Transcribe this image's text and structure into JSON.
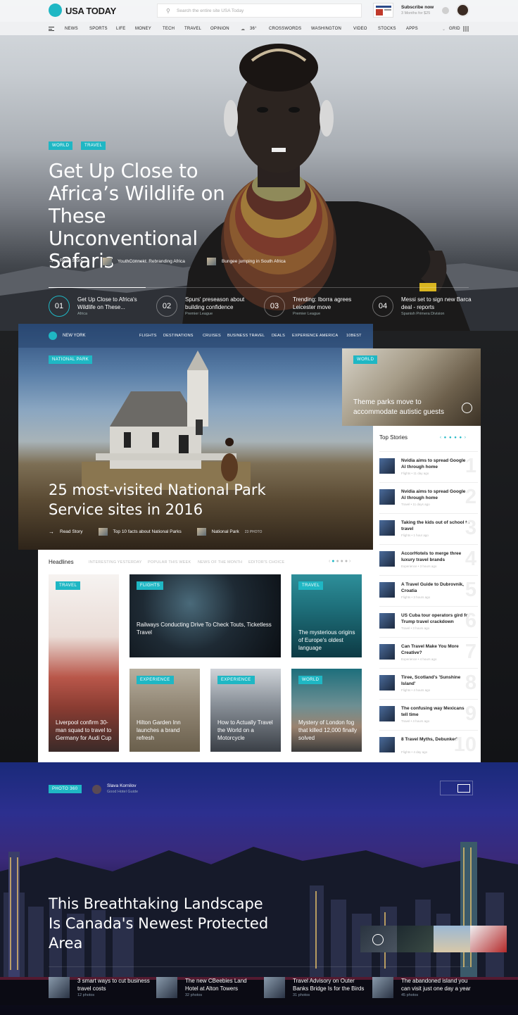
{
  "header": {
    "logo": "USA TODAY",
    "search_placeholder": "Search the entire site USA Today",
    "subscribe_title": "Subscribe now",
    "subscribe_sub": "3 Months for $25"
  },
  "nav": {
    "items": [
      "NEWS",
      "SPORTS",
      "LIFE",
      "MONEY",
      "TECH",
      "TRAVEL",
      "OPINION"
    ],
    "weather": "36°",
    "items2": [
      "CROSSWORDS",
      "WASHINGTON",
      "VIDEO",
      "STOCKS",
      "APPS"
    ],
    "grid_label": "GRID"
  },
  "hero": {
    "tags": [
      "WORLD",
      "TRAVEL"
    ],
    "title": "Get Up Close to Africa’s Wildlife on These Unconventional Safaris",
    "read_story": "Read Story",
    "related1": "YouthConnekt: Rebranding Africa",
    "related2": "Bungee jumping in South Africa",
    "stories": [
      {
        "num": "01",
        "title": "Get Up Close to Africa's Wildlife on These...",
        "sub": "Africa"
      },
      {
        "num": "02",
        "title": "Spurs' preseason about building confidence",
        "sub": "Premier League"
      },
      {
        "num": "03",
        "title": "Trending: Iborra agrees Leicester move",
        "sub": "Premier League"
      },
      {
        "num": "04",
        "title": "Messi set to sign new Barca deal - reports",
        "sub": "Spanish Primera Division"
      }
    ]
  },
  "travel": {
    "city": "NEW YORK",
    "nav": [
      "FLIGHTS",
      "DESTINATIONS",
      "CRUISES",
      "BUSINESS TRAVEL",
      "DEALS",
      "EXPERIENCE AMERICA",
      "10BEST"
    ],
    "tag": "NATIONAL PARK",
    "title": "25 most-visited National Park Service sites in 2016",
    "read_story": "Read Story",
    "related1": "Top 10 facts about National Parks",
    "related2": "National Park",
    "related2_count": "23 PHOTO"
  },
  "world_card": {
    "tag": "WORLD",
    "title": "Theme parks move to accommodate autistic guests"
  },
  "top_stories": {
    "title": "Top Stories",
    "items": [
      {
        "title": "Nvidia aims to spread Google AI through home",
        "cat": "Flights",
        "time": "11 day ago",
        "num": "1"
      },
      {
        "title": "Nvidia aims to spread Google AI through home",
        "cat": "Travel",
        "time": "11 days ago",
        "num": "2"
      },
      {
        "title": "Taking the kids out of school to travel",
        "cat": "Flights",
        "time": "1 hour ago",
        "num": "3"
      },
      {
        "title": "AccorHotels to merge three luxury travel brands",
        "cat": "Experience",
        "time": "3 hours ago",
        "num": "4"
      },
      {
        "title": "A Travel Guide to Dubrovnik, Croatia",
        "cat": "Flights",
        "time": "3 hours ago",
        "num": "5"
      },
      {
        "title": "US Cuba tour operators gird for Trump travel crackdown",
        "cat": "Travel",
        "time": "3 hours ago",
        "num": "6"
      },
      {
        "title": "Can Travel Make You More Creative?",
        "cat": "Experience",
        "time": "4 hours ago",
        "num": "7"
      },
      {
        "title": "Tiree, Scotland's 'Sunshine Island'",
        "cat": "Flights",
        "time": "4 hours ago",
        "num": "8"
      },
      {
        "title": "The confusing way Mexicans tell time",
        "cat": "Travel",
        "time": "4 hours ago",
        "num": "9"
      },
      {
        "title": "8 Travel Myths, Debunked",
        "cat": "Flights",
        "time": "4 day ago",
        "num": "10"
      }
    ]
  },
  "headlines": {
    "title": "Headlines",
    "tabs": [
      "INTERESTING YESTERDAY",
      "POPULAR THIS WEEK",
      "NEWS OF THE MONTH",
      "EDITOR'S CHOICE"
    ],
    "cards": [
      {
        "tag": "TRAVEL",
        "title": "Liverpool confirm 30-man squad to travel to Germany for Audi Cup"
      },
      {
        "tag": "FLIGHTS",
        "title": "Railways Conducting Drive To Check Touts, Ticketless Travel"
      },
      {
        "tag": "TRAVEL",
        "title": "The mysterious origins of Europe's oldest language"
      },
      {
        "tag": "EXPERIENCE",
        "title": "Hilton Garden Inn launches a brand refresh"
      },
      {
        "tag": "EXPERIENCE",
        "title": "How to Actually Travel the World on a Motorcycle"
      },
      {
        "tag": "WORLD",
        "title": "Mystery of London fog that killed 12,000 finally solved"
      }
    ]
  },
  "photo360": {
    "tag": "PHOTO 360",
    "author": "Slava Kornilov",
    "author_sub": "Good Hotel Guide",
    "title": "This Breathtaking Landscape Is Canada's Newest Protected Area",
    "bottom": [
      {
        "title": "3 smart ways to cut business travel costs",
        "sub": "12 photos"
      },
      {
        "title": "The new CBeebies Land Hotel at Alton Towers",
        "sub": "32 photos"
      },
      {
        "title": "Travel Advisory on Outer Banks Bridge Is for the Birds",
        "sub": "31 photos"
      },
      {
        "title": "The abandoned island you can visit just one day a year",
        "sub": "45 photos"
      }
    ]
  },
  "colors": {
    "accent": "#1fb7c4"
  }
}
